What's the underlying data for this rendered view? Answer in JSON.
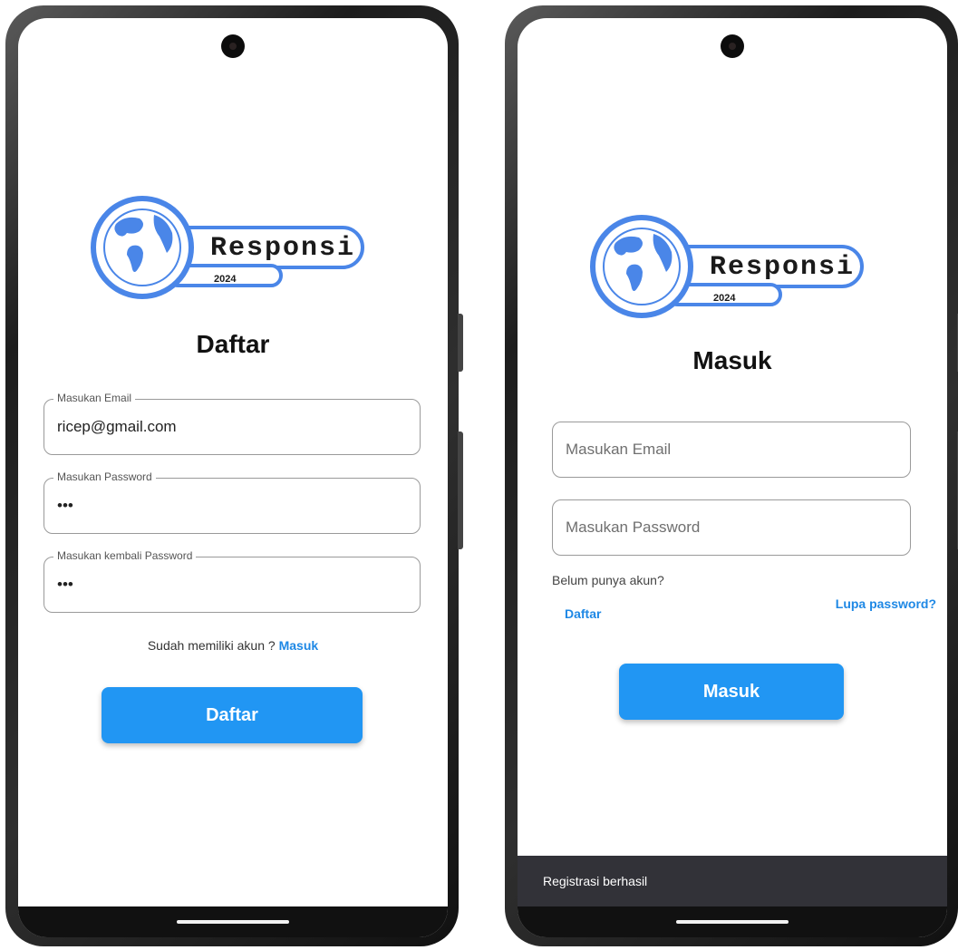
{
  "colors": {
    "primary": "#2196f3",
    "link": "#1e88e5",
    "snackbar": "#323238"
  },
  "logo": {
    "word": "Responsi",
    "year": "2024"
  },
  "register": {
    "title": "Daftar",
    "email": {
      "label": "Masukan Email",
      "value": "ricep@gmail.com"
    },
    "password": {
      "label": "Masukan Password",
      "value": "•••"
    },
    "confirm": {
      "label": "Masukan kembali Password",
      "value": "•••"
    },
    "prompt": "Sudah memiliki akun ?",
    "prompt_link": "Masuk",
    "button": "Daftar"
  },
  "login": {
    "title": "Masuk",
    "email_placeholder": "Masukan Email",
    "password_placeholder": "Masukan Password",
    "no_account": "Belum punya akun?",
    "register_link": "Daftar",
    "forgot_link": "Lupa password?",
    "button": "Masuk",
    "snackbar": "Registrasi berhasil"
  }
}
